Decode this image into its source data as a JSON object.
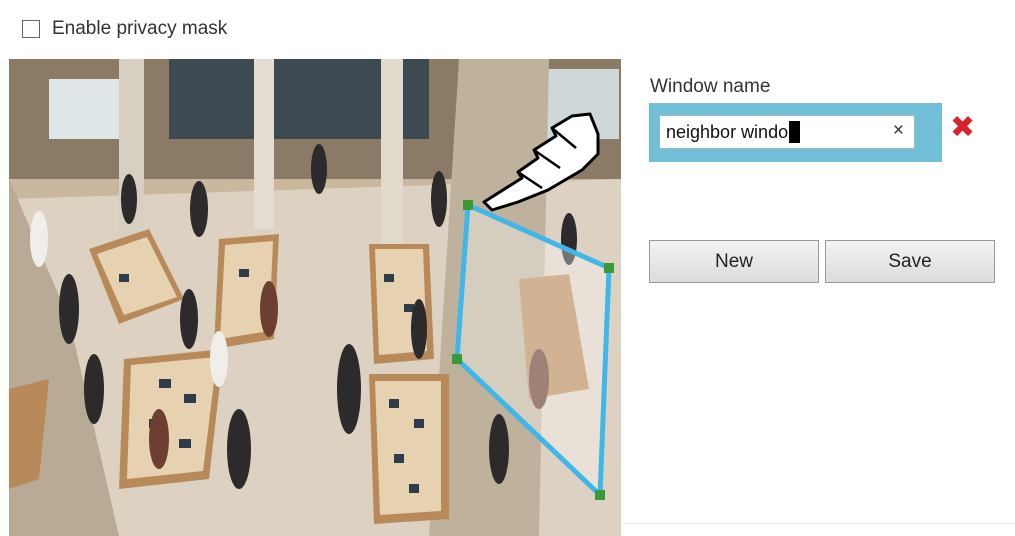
{
  "privacy_mask": {
    "label": "Enable privacy mask",
    "checked": false
  },
  "window_name": {
    "label": "Window name",
    "value": "neighbor windo",
    "clear_glyph": "×",
    "delete_glyph": "✖"
  },
  "buttons": {
    "new_label": "New",
    "save_label": "Save"
  },
  "colors": {
    "mask_outline": "#3fb7e8",
    "handle": "#3a9a3a",
    "input_highlight": "#72c0d7",
    "delete": "#d9232b"
  },
  "icons": {
    "cursor": "hand-pointer-icon",
    "clear": "clear-icon",
    "delete": "delete-icon"
  }
}
